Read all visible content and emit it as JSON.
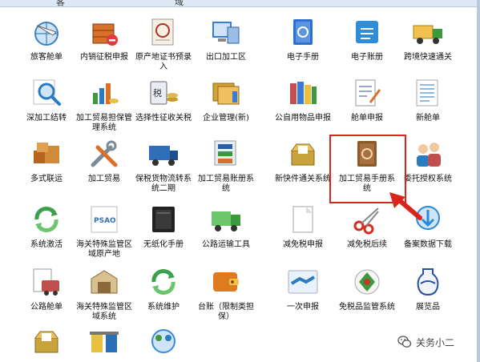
{
  "top_hints": [
    "客",
    "域"
  ],
  "tiles": [
    {
      "id": "lvke-cangdan",
      "label": "旅客舱单",
      "icon": "globe-plane-icon",
      "color": "#3b82c4"
    },
    {
      "id": "neixiao-zhengshui",
      "label": "内销征税申报",
      "icon": "box-minus-icon",
      "color": "#d9702a"
    },
    {
      "id": "yuanchandi-zhengshu",
      "label": "原产地证书预录入",
      "icon": "certificate-icon",
      "color": "#b03030"
    },
    {
      "id": "chukou-jiagongqu",
      "label": "出口加工区",
      "icon": "computer-building-icon",
      "color": "#3a7bd5"
    },
    {
      "id": "dianzi-shouce",
      "label": "电子手册",
      "icon": "blue-book-icon",
      "color": "#2f6fd0"
    },
    {
      "id": "dianzi-zhangce",
      "label": "电子账册",
      "icon": "blue-ledger-icon",
      "color": "#2e8fd8"
    },
    {
      "id": "kuajing-kuaisu",
      "label": "跨境快速通关",
      "icon": "truck-icon",
      "color": "#e0a020"
    },
    {
      "id": "shenjiagong-jiezhuan",
      "label": "深加工结转",
      "icon": "magnifier-icon",
      "color": "#2a7cc0"
    },
    {
      "id": "jiagong-danbao",
      "label": "加工贸易担保管理系统",
      "icon": "chart-coins-icon",
      "color": "#3c9a3c"
    },
    {
      "id": "xuanze-zhengshui",
      "label": "选择性征收关税",
      "icon": "tax-calculator-icon",
      "color": "#c89a2a"
    },
    {
      "id": "qiye-guanli",
      "label": "企业管理(新)",
      "icon": "folders-icon",
      "color": "#d4a03a"
    },
    {
      "id": "gongzi-wupin",
      "label": "公自用物品申报",
      "icon": "books-icon",
      "color": "#c0504d"
    },
    {
      "id": "cangdan-shenbao",
      "label": "舱单申报",
      "icon": "document-pen-icon",
      "color": "#6b8fc4"
    },
    {
      "id": "xin-cangdan",
      "label": "新舱单",
      "icon": "list-document-icon",
      "color": "#6aa0d8"
    },
    {
      "id": "duoshi-lianyun",
      "label": "多式联运",
      "icon": "cargo-boxes-icon",
      "color": "#b5651d"
    },
    {
      "id": "jiagong-maoyi",
      "label": "加工贸易",
      "icon": "tools-icon",
      "color": "#7a8a99"
    },
    {
      "id": "baoshui-huowu",
      "label": "保税货物流转系统二期",
      "icon": "blue-truck-icon",
      "color": "#2f6fb8"
    },
    {
      "id": "jiagong-zhangce",
      "label": "加工贸易账册系统",
      "icon": "database-icon",
      "color": "#2a5fa8"
    },
    {
      "id": "xinkuaijian-tongguan",
      "label": "新快件通关系统",
      "icon": "open-box-icon",
      "color": "#c8a23a"
    },
    {
      "id": "jiagong-shouce",
      "label": "加工贸易手册系统",
      "icon": "brown-book-icon",
      "color": "#8a5a2a"
    },
    {
      "id": "weituo-shouquan",
      "label": "委托授权系统",
      "icon": "people-icon",
      "color": "#c0504d"
    },
    {
      "id": "xitong-jihuo",
      "label": "系统激活",
      "icon": "green-refresh-icon",
      "color": "#3aa04a"
    },
    {
      "id": "haiguan-teshu-chandi",
      "label": "海关特殊监管区域原产地",
      "icon": "psao-icon",
      "color": "#3a6fb0"
    },
    {
      "id": "wuzhihua-shouce",
      "label": "无纸化手册",
      "icon": "black-card-icon",
      "color": "#222222"
    },
    {
      "id": "gonglu-yunshu",
      "label": "公路运输工具",
      "icon": "green-truck-icon",
      "color": "#3c9a3c"
    },
    {
      "id": "jianmian-shenbao",
      "label": "减免税申报",
      "icon": "white-page-icon",
      "color": "#d0d0d0"
    },
    {
      "id": "jianmian-houxu",
      "label": "减免税后续",
      "icon": "scissors-icon",
      "color": "#d62d20"
    },
    {
      "id": "beian-shuju",
      "label": "备案数据下载",
      "icon": "globe-download-icon",
      "color": "#2a8ad8"
    },
    {
      "id": "gonglu-cangdan",
      "label": "公路舱单",
      "icon": "clipboard-bus-icon",
      "color": "#c0504d"
    },
    {
      "id": "haiguan-teshu-xitong",
      "label": "海关特殊监管区域系统",
      "icon": "warehouse-icon",
      "color": "#8a6a3a"
    },
    {
      "id": "xitong-weihu",
      "label": "系统维护",
      "icon": "green-arrows-icon",
      "color": "#3aa04a"
    },
    {
      "id": "taizhang",
      "label": "台账（限制类担保）",
      "icon": "orange-wallet-icon",
      "color": "#e07a20"
    },
    {
      "id": "yici-shenbao",
      "label": "一次申报",
      "icon": "handshake-icon",
      "color": "#2a7cc0"
    },
    {
      "id": "mianshuipin",
      "label": "免税品监管系统",
      "icon": "tag-icon",
      "color": "#c0392b"
    },
    {
      "id": "juanzangpin",
      "label": "展览品",
      "icon": "vase-icon",
      "color": "#2a4fa8"
    },
    {
      "id": "row7-a",
      "label": "",
      "icon": "open-box-icon",
      "color": "#c8a23a"
    },
    {
      "id": "row7-b",
      "label": "",
      "icon": "recycle-bins-icon",
      "color": "#2a6fb8"
    },
    {
      "id": "row7-c",
      "label": "",
      "icon": "people-globe-icon",
      "color": "#3a8ad8"
    }
  ],
  "highlight_label": "加工贸易手册系统",
  "watermark": {
    "text": "关务小二",
    "icon": "wechat-icon"
  }
}
